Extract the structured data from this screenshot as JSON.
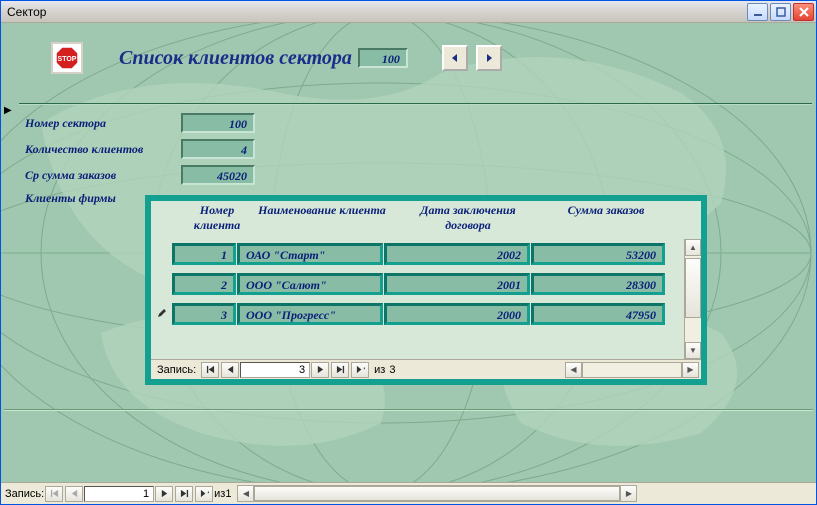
{
  "window": {
    "title": "Сектор"
  },
  "heading": "Список клиентов сектора",
  "sector_code_top": "100",
  "fields": {
    "sector_label": "Номер сектора",
    "sector_value": "100",
    "count_label": "Количество клиентов",
    "count_value": "4",
    "avg_label": "Ср сумма заказов",
    "avg_value": "45020",
    "clients_label": "Клиенты фирмы"
  },
  "subform": {
    "headers": {
      "num": "Номер клиента",
      "name": "Наименование клиента",
      "date": "Дата заключения договора",
      "sum": "Сумма заказов"
    },
    "rows": [
      {
        "num": "1",
        "name": "ОАО \"Старт\"",
        "date": "2002",
        "sum": "53200"
      },
      {
        "num": "2",
        "name": "ООО \"Салют\"",
        "date": "2001",
        "sum": "28300"
      },
      {
        "num": "3",
        "name": "ООО \"Прогресс\"",
        "date": "2000",
        "sum": "47950"
      }
    ],
    "nav": {
      "label": "Запись:",
      "current": "3",
      "of_label": "из",
      "total": "3"
    }
  },
  "outer_nav": {
    "label": "Запись:",
    "current": "1",
    "of_label": "из",
    "total": "1"
  }
}
